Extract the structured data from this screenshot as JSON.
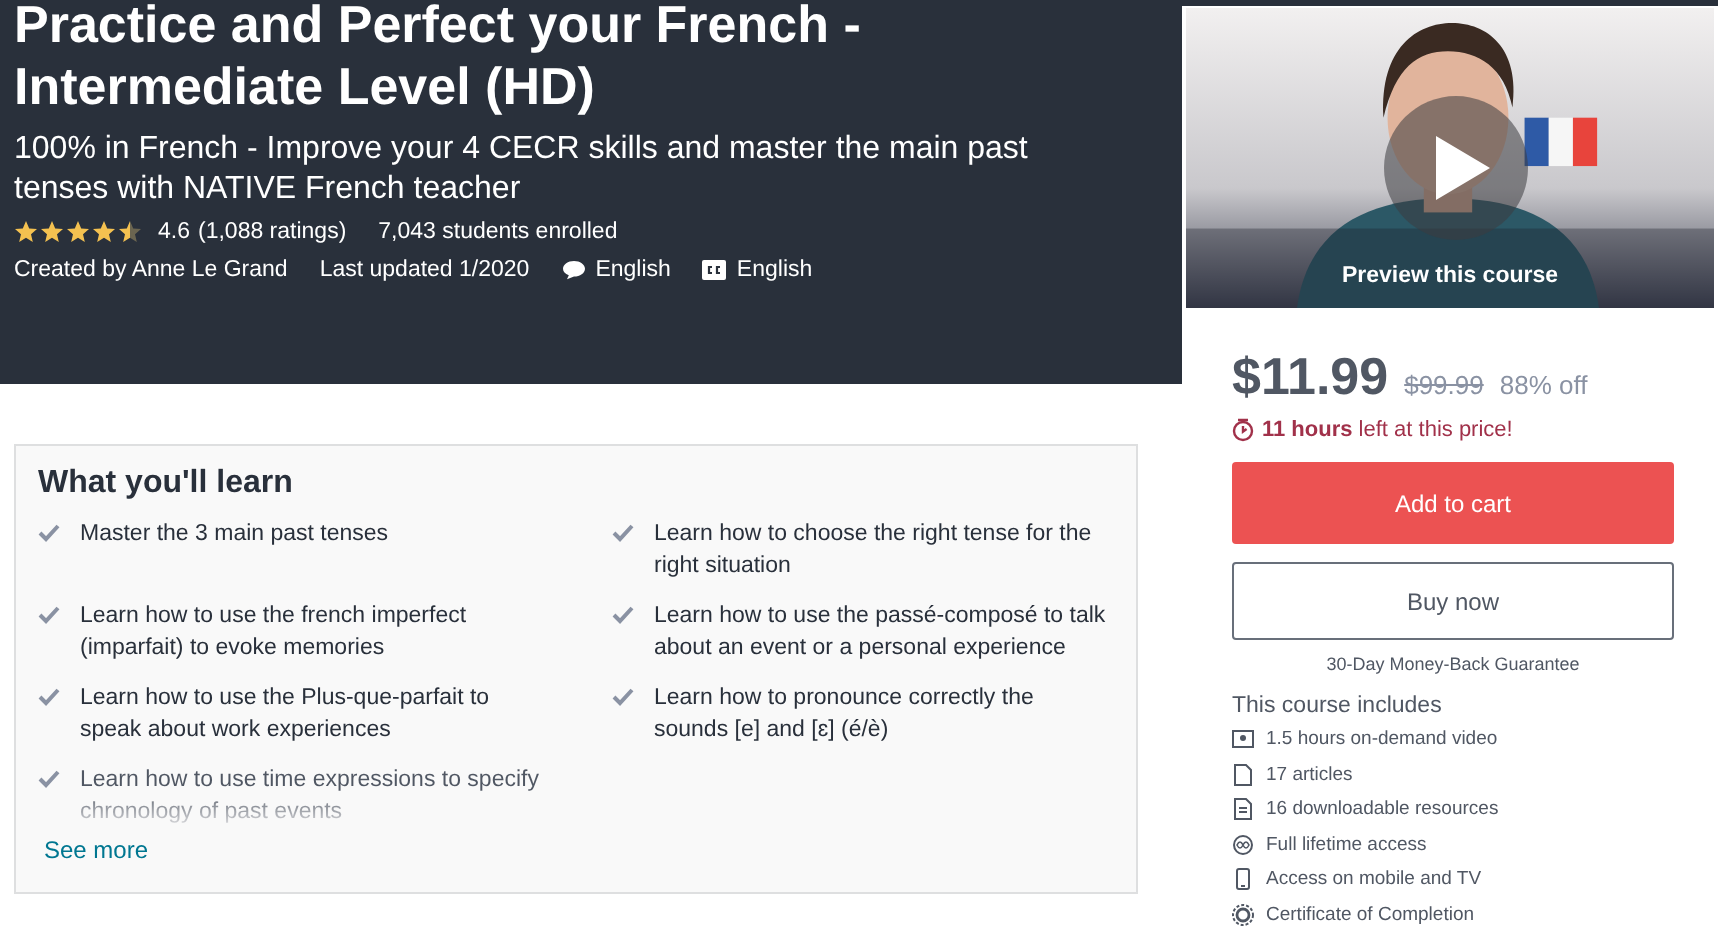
{
  "header": {
    "title": "Practice and Perfect your French - Intermediate Level (HD)",
    "subtitle": "100% in French - Improve your 4 CECR skills and master the main past tenses with NATIVE French teacher",
    "stars": 4.5,
    "rating": "4.6",
    "ratings_count": "(1,088 ratings)",
    "enrolled": "7,043 students enrolled",
    "created_by": "Created by Anne Le Grand",
    "last_updated": "Last updated 1/2020",
    "language": "English",
    "captions": "English"
  },
  "learn": {
    "title": "What you'll learn",
    "items": [
      {
        "text": "Master the 3 main past tenses",
        "faded": false
      },
      {
        "text": "Learn how to choose the right tense for the right situation",
        "faded": false
      },
      {
        "text": "Learn how to use the french imperfect (imparfait) to evoke memories",
        "faded": false
      },
      {
        "text": "Learn how to use the passé-composé to talk about an event or a personal experience",
        "faded": false
      },
      {
        "text": "Learn how to use the Plus-que-parfait to speak about work experiences",
        "faded": false
      },
      {
        "text": "Learn how to pronounce correctly the sounds [e] and [ɛ] (é/è)",
        "faded": false
      },
      {
        "text": "Learn how to use time expressions to specify chronology of past events",
        "faded": true
      }
    ],
    "see_more": "See more"
  },
  "sidebar": {
    "preview": {
      "kind": "picture",
      "label": "Preview this course"
    },
    "price": "$11.99",
    "old_price": "$99.99",
    "discount": "88% off",
    "timer_bold": "11 hours",
    "timer_rest": "left at this price!",
    "add_to_cart": "Add to cart",
    "buy_now": "Buy now",
    "guarantee": "30-Day Money-Back Guarantee",
    "includes_title": "This course includes",
    "includes": [
      {
        "kind": "video",
        "text": "1.5 hours on-demand video"
      },
      {
        "kind": "article",
        "text": "17 articles"
      },
      {
        "kind": "resource",
        "text": "16 downloadable resources"
      },
      {
        "kind": "lifetime",
        "text": "Full lifetime access"
      },
      {
        "kind": "mobile",
        "text": "Access on mobile and TV"
      },
      {
        "kind": "certificate",
        "text": "Certificate of Completion"
      }
    ]
  }
}
